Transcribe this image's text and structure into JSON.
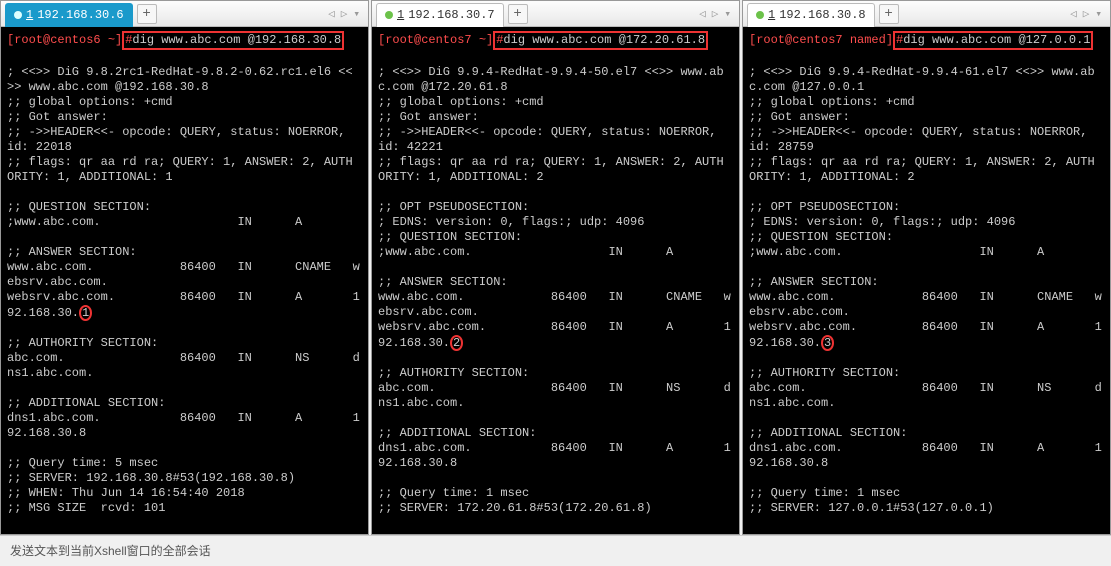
{
  "footer_text": "发送文本到当前Xshell窗口的全部会话",
  "tabbar_right": {
    "left": "◁",
    "right": "▷",
    "menu": "▾"
  },
  "panes": [
    {
      "tab": {
        "index": "1",
        "title": "192.168.30.6",
        "active": true
      },
      "prompt": {
        "user_host": "[root@centos6 ~]",
        "hash": "#",
        "cmd": "dig www.abc.com @192.168.30.8"
      },
      "body": [
        "",
        "; <<>> DiG 9.8.2rc1-RedHat-9.8.2-0.62.rc1.el6 <<",
        ">> www.abc.com @192.168.30.8",
        ";; global options: +cmd",
        ";; Got answer:",
        ";; ->>HEADER<<- opcode: QUERY, status: NOERROR,",
        "id: 22018",
        ";; flags: qr aa rd ra; QUERY: 1, ANSWER: 2, AUTH",
        "ORITY: 1, ADDITIONAL: 1",
        "",
        ";; QUESTION SECTION:",
        ";www.abc.com.                   IN      A",
        "",
        ";; ANSWER SECTION:",
        "www.abc.com.            86400   IN      CNAME   w",
        "ebsrv.abc.com.",
        {
          "pre": "websrv.abc.com.         86400   IN      A       1\n92.168.30.",
          "circled": "1"
        },
        "",
        ";; AUTHORITY SECTION:",
        "abc.com.                86400   IN      NS      d",
        "ns1.abc.com.",
        "",
        ";; ADDITIONAL SECTION:",
        "dns1.abc.com.           86400   IN      A       1",
        "92.168.30.8",
        "",
        ";; Query time: 5 msec",
        ";; SERVER: 192.168.30.8#53(192.168.30.8)",
        ";; WHEN: Thu Jun 14 16:54:40 2018",
        ";; MSG SIZE  rcvd: 101",
        ""
      ]
    },
    {
      "tab": {
        "index": "1",
        "title": "192.168.30.7",
        "active": false
      },
      "prompt": {
        "user_host": "[root@centos7 ~]",
        "hash": "#",
        "cmd": "dig www.abc.com @172.20.61.8"
      },
      "body": [
        "",
        "; <<>> DiG 9.9.4-RedHat-9.9.4-50.el7 <<>> www.ab",
        "c.com @172.20.61.8",
        ";; global options: +cmd",
        ";; Got answer:",
        ";; ->>HEADER<<- opcode: QUERY, status: NOERROR,",
        "id: 42221",
        ";; flags: qr aa rd ra; QUERY: 1, ANSWER: 2, AUTH",
        "ORITY: 1, ADDITIONAL: 2",
        "",
        ";; OPT PSEUDOSECTION:",
        "; EDNS: version: 0, flags:; udp: 4096",
        ";; QUESTION SECTION:",
        ";www.abc.com.                   IN      A",
        "",
        ";; ANSWER SECTION:",
        "www.abc.com.            86400   IN      CNAME   w",
        "ebsrv.abc.com.",
        {
          "pre": "websrv.abc.com.         86400   IN      A       1\n92.168.30.",
          "circled": "2"
        },
        "",
        ";; AUTHORITY SECTION:",
        "abc.com.                86400   IN      NS      d",
        "ns1.abc.com.",
        "",
        ";; ADDITIONAL SECTION:",
        "dns1.abc.com.           86400   IN      A       1",
        "92.168.30.8",
        "",
        ";; Query time: 1 msec",
        ";; SERVER: 172.20.61.8#53(172.20.61.8)"
      ]
    },
    {
      "tab": {
        "index": "1",
        "title": "192.168.30.8",
        "active": false
      },
      "prompt": {
        "user_host": "[root@centos7 named]",
        "hash": "#",
        "cmd": "dig www.abc.com @127.0.0.1"
      },
      "body": [
        "",
        "; <<>> DiG 9.9.4-RedHat-9.9.4-61.el7 <<>> www.ab",
        "c.com @127.0.0.1",
        ";; global options: +cmd",
        ";; Got answer:",
        ";; ->>HEADER<<- opcode: QUERY, status: NOERROR,",
        "id: 28759",
        ";; flags: qr aa rd ra; QUERY: 1, ANSWER: 2, AUTH",
        "ORITY: 1, ADDITIONAL: 2",
        "",
        ";; OPT PSEUDOSECTION:",
        "; EDNS: version: 0, flags:; udp: 4096",
        ";; QUESTION SECTION:",
        ";www.abc.com.                   IN      A",
        "",
        ";; ANSWER SECTION:",
        "www.abc.com.            86400   IN      CNAME   w",
        "ebsrv.abc.com.",
        {
          "pre": "websrv.abc.com.         86400   IN      A       1\n92.168.30.",
          "circled": "3"
        },
        "",
        ";; AUTHORITY SECTION:",
        "abc.com.                86400   IN      NS      d",
        "ns1.abc.com.",
        "",
        ";; ADDITIONAL SECTION:",
        "dns1.abc.com.           86400   IN      A       1",
        "92.168.30.8",
        "",
        ";; Query time: 1 msec",
        ";; SERVER: 127.0.0.1#53(127.0.0.1)"
      ]
    }
  ]
}
